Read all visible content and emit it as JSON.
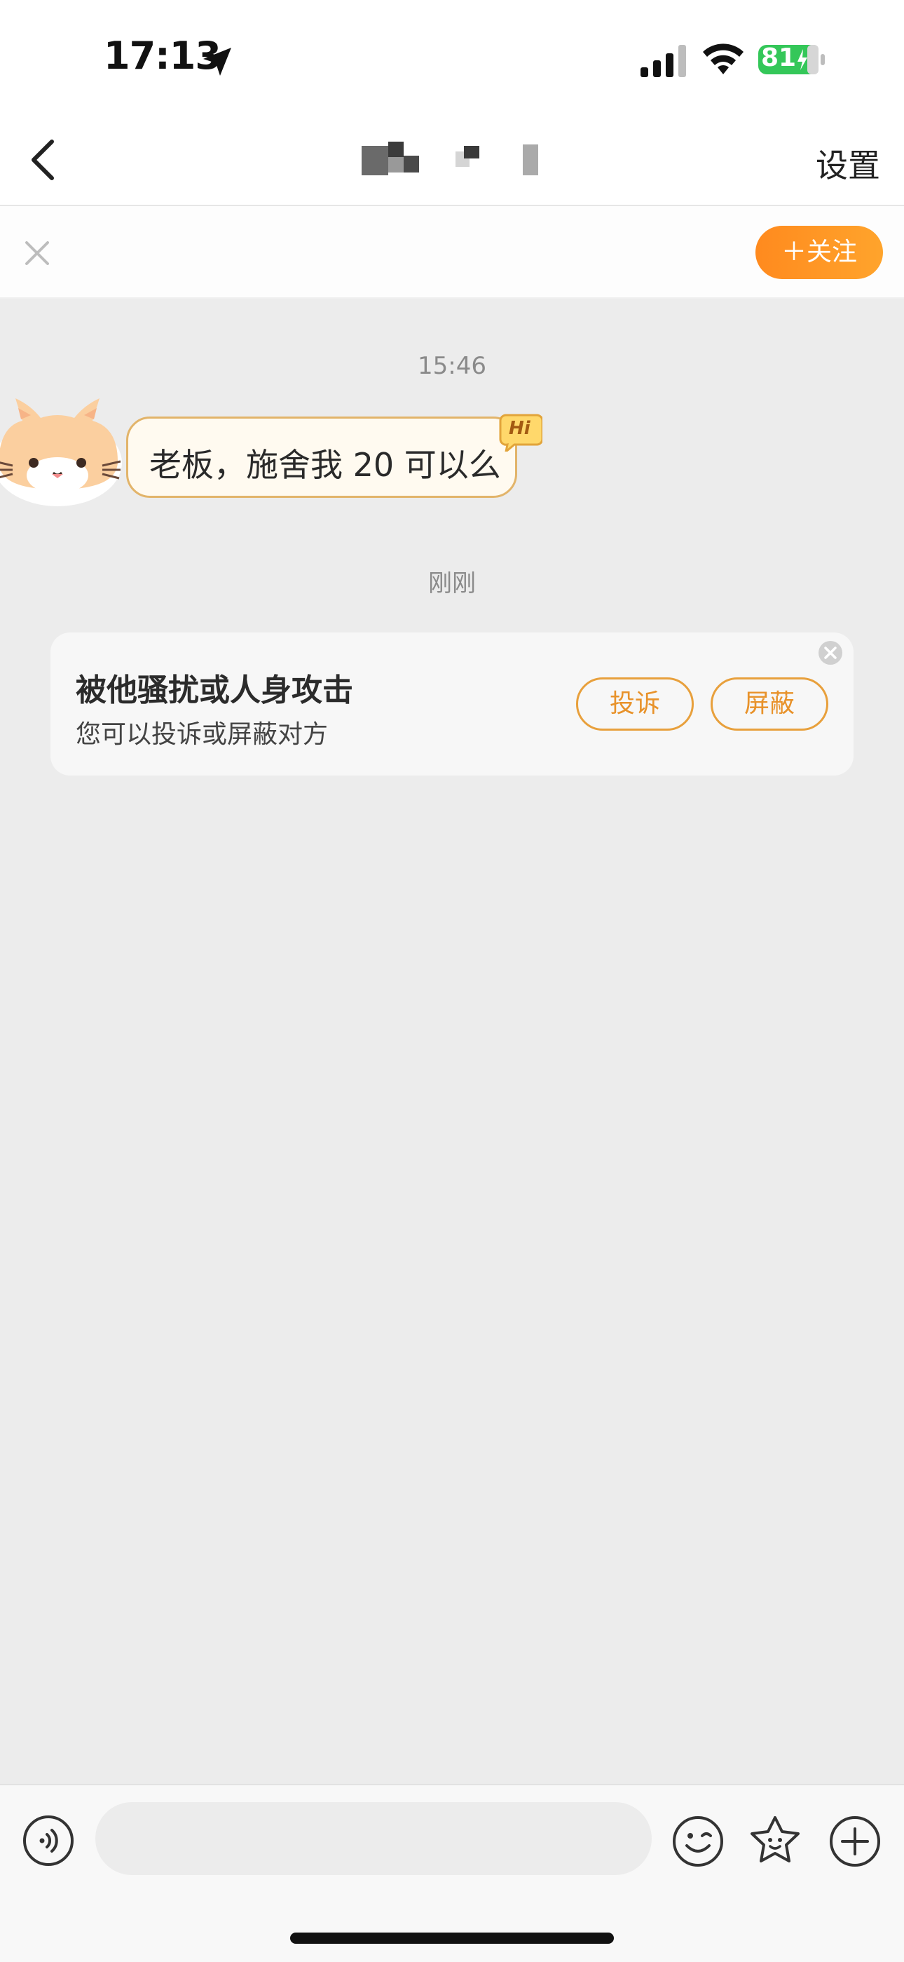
{
  "status_bar": {
    "time": "17:13",
    "battery": "81",
    "icons": [
      "location-arrow-icon",
      "signal-icon",
      "wifi-icon",
      "battery-charging-icon"
    ]
  },
  "nav": {
    "back_icon": "chevron-left-icon",
    "settings_label": "设置"
  },
  "follow_banner": {
    "close_icon": "close-icon",
    "follow_label": "＋关注",
    "accent": "#ff8f1f"
  },
  "chat": {
    "messages": [
      {
        "timestamp": "15:46",
        "text": "老板，施舍我 20 可以么",
        "badge": "Hi"
      }
    ],
    "notice_timestamp": "刚刚",
    "report_card": {
      "title": "被他骚扰或人身攻击",
      "subtitle": "您可以投诉或屏蔽对方",
      "complain_label": "投诉",
      "block_label": "屏蔽"
    }
  },
  "input_bar": {
    "placeholder": "",
    "icons": [
      "voice-icon",
      "emoji-icon",
      "sticker-icon",
      "plus-icon"
    ]
  },
  "colors": {
    "chat_background": "#ececec",
    "accent_orange": "#e8922a",
    "bubble_border": "#e2b46a"
  }
}
